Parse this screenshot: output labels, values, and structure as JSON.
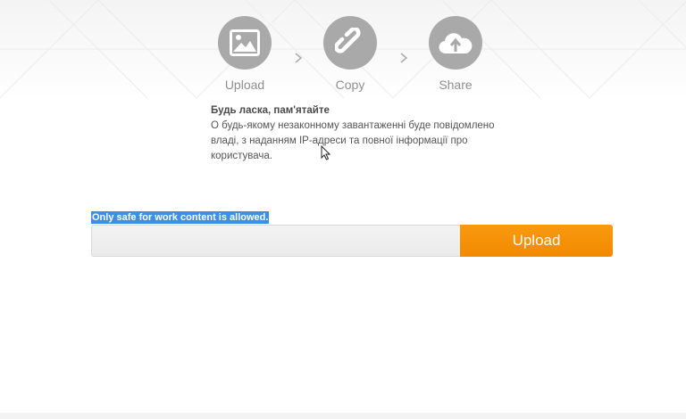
{
  "steps": [
    {
      "label": "Upload",
      "icon": "image-icon"
    },
    {
      "label": "Copy",
      "icon": "link-icon"
    },
    {
      "label": "Share",
      "icon": "cloud-upload-icon"
    }
  ],
  "notice": {
    "title": "Будь ласка, пам'ятайте",
    "body": "О будь-якому незаконному завантаженні буде повідомлено владі, з наданням IP-адреси та повної інформації про користувача."
  },
  "upload": {
    "sfw_notice": "Only safe for work content is allowed.",
    "button_label": "Upload"
  },
  "colors": {
    "accent": "#f7941d",
    "icon_circle": "#a9a9a9",
    "selection": "#3c8fe3"
  }
}
